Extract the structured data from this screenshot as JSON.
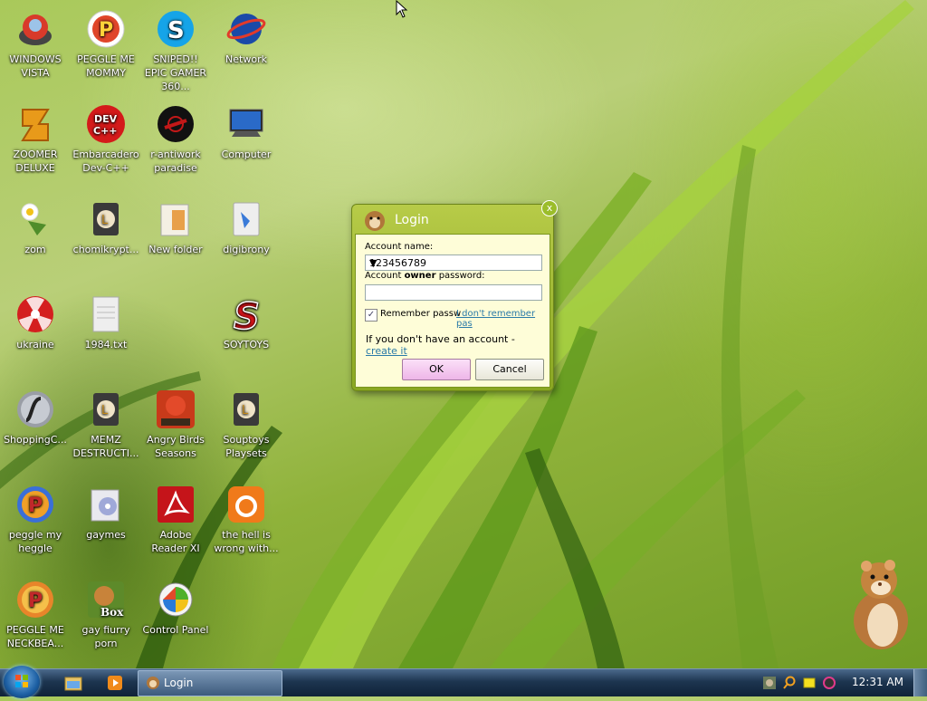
{
  "desktop_icons": [
    {
      "label": "WINDOWS VISTA",
      "icon": "windows-vista-icon"
    },
    {
      "label": "PEGGLE ME MOMMY",
      "icon": "peggle-icon"
    },
    {
      "label": "SNIPED!! EPIC GAMER 360...",
      "icon": "skype-icon"
    },
    {
      "label": "Network",
      "icon": "network-icon"
    },
    {
      "label": "ZOOMER DELUXE",
      "icon": "zoomer-deluxe-icon"
    },
    {
      "label": "Embarcadero Dev-C++",
      "icon": "dev-cpp-icon"
    },
    {
      "label": "r-antiwork paradise",
      "icon": "antiwork-icon"
    },
    {
      "label": "Computer",
      "icon": "computer-icon"
    },
    {
      "label": "zom",
      "icon": "zom-icon"
    },
    {
      "label": "chomikrypt...",
      "icon": "chomikrypt-icon"
    },
    {
      "label": "New folder",
      "icon": "folder-icon"
    },
    {
      "label": "digibrony",
      "icon": "digibrony-icon"
    },
    {
      "label": "ukraine",
      "icon": "ukraine-icon"
    },
    {
      "label": "1984.txt",
      "icon": "text-file-icon"
    },
    {
      "label": "SOYTOYS",
      "icon": "soytoys-icon"
    },
    {
      "label": "ShoppingC...",
      "icon": "flash-icon"
    },
    {
      "label": "MEMZ DESTRUCTI...",
      "icon": "memz-icon"
    },
    {
      "label": "Angry Birds Seasons",
      "icon": "angry-birds-icon"
    },
    {
      "label": "Souptoys Playsets",
      "icon": "souptoys-icon"
    },
    {
      "label": "peggle my heggle",
      "icon": "peggle-my-heggle-icon"
    },
    {
      "label": "gaymes",
      "icon": "gaymes-folder-icon"
    },
    {
      "label": "Adobe Reader XI",
      "icon": "adobe-reader-icon"
    },
    {
      "label": "the hell is wrong with...",
      "icon": "uc-browser-icon"
    },
    {
      "label": "PEGGLE ME NECKBEA...",
      "icon": "peggle-neckbeard-icon"
    },
    {
      "label": "gay fiurry porn",
      "icon": "box-hamster-icon"
    },
    {
      "label": "Control Panel",
      "icon": "control-panel-icon"
    }
  ],
  "login_dialog": {
    "title": "Login",
    "account_name_label": "Account name:",
    "account_name_value": "123456789",
    "password_label_prefix": "Account ",
    "password_label_bold": "owner",
    "password_label_suffix": " password:",
    "password_value": "",
    "remember_checked": true,
    "remember_label": "Remember passw",
    "forgot_link": "I don't remember pas",
    "no_account_text": "If you don't have an account - ",
    "create_link": "create it",
    "ok_label": "OK",
    "cancel_label": "Cancel",
    "close_glyph": "x"
  },
  "taskbar": {
    "login_task_label": "Login",
    "clock": "12:31 AM"
  },
  "colors": {
    "dialog_frame": "#a6bf35",
    "dialog_body": "#fefdd8",
    "ok_button": "#f5c8f0",
    "link": "#2a7aa8"
  }
}
